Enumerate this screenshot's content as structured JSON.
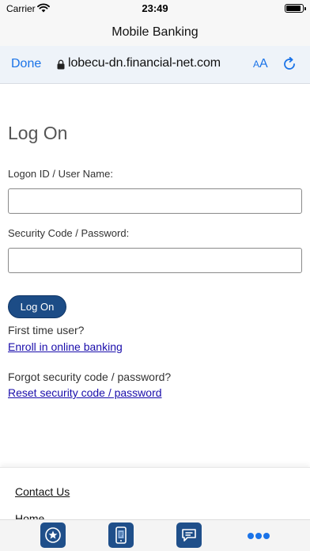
{
  "status_bar": {
    "carrier": "Carrier",
    "time": "23:49",
    "wifi_icon": "wifi-icon",
    "battery_icon": "battery-icon"
  },
  "app": {
    "title": "Mobile Banking"
  },
  "browser": {
    "done_label": "Done",
    "url": "lobecu-dn.financial-net.com",
    "lock_icon": "lock-icon",
    "text_size_small": "A",
    "text_size_large": "A",
    "reload_icon": "reload-icon",
    "accent_color": "#1a73e8"
  },
  "form": {
    "heading": "Log On",
    "username_label": "Logon ID / User Name:",
    "username_value": "",
    "password_label": "Security Code / Password:",
    "password_value": "",
    "submit_label": "Log On",
    "submit_color": "#1c4c86"
  },
  "help": {
    "first_time_prompt": "First time user?",
    "enroll_link": "Enroll in online banking",
    "forgot_prompt": "Forgot security code / password?",
    "reset_link": "Reset security code / password",
    "link_color": "#1a0dab"
  },
  "footer": {
    "links": [
      "Contact Us",
      "Home"
    ]
  },
  "tab_bar": {
    "items": [
      {
        "icon": "star-badge-icon"
      },
      {
        "icon": "mobile-deposit-icon"
      },
      {
        "icon": "chat-icon"
      },
      {
        "icon": "more-dots-icon"
      }
    ],
    "tab_color": "#1f4f8a"
  }
}
